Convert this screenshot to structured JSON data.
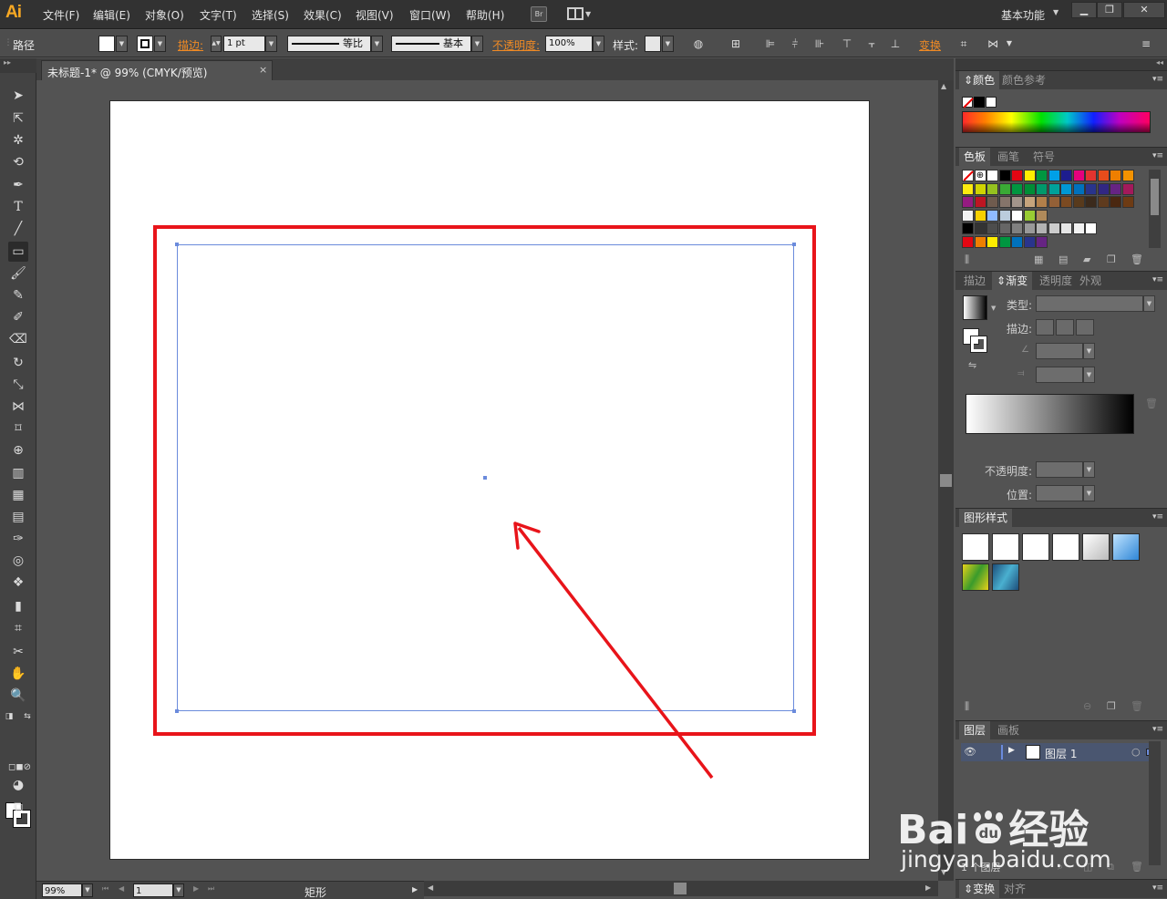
{
  "app": {
    "logo": "Ai",
    "menu": [
      "文件(F)",
      "编辑(E)",
      "对象(O)",
      "文字(T)",
      "选择(S)",
      "效果(C)",
      "视图(V)",
      "窗口(W)",
      "帮助(H)"
    ],
    "bridge_label": "Br",
    "workspace": "基本功能"
  },
  "control_bar": {
    "selection_label": "路径",
    "stroke_label": "描边:",
    "stroke_weight": "1 pt",
    "profile_label": "等比",
    "brush_label": "基本",
    "opacity_label": "不透明度:",
    "opacity_value": "100%",
    "style_label": "样式:",
    "transform_label": "变换"
  },
  "document": {
    "tab_title": "未标题-1* @ 99% (CMYK/预览)",
    "close_symbol": "×"
  },
  "status_bar": {
    "zoom": "99%",
    "page": "1",
    "tool_name": "矩形"
  },
  "panels": {
    "color": {
      "tabs": [
        "颜色",
        "颜色参考"
      ]
    },
    "swatches": {
      "tabs": [
        "色板",
        "画笔",
        "符号"
      ]
    },
    "gradient": {
      "tabs": [
        "描边",
        "渐变",
        "透明度",
        "外观"
      ],
      "type_label": "类型:",
      "stroke_label": "描边:",
      "opacity_label": "不透明度:",
      "position_label": "位置:"
    },
    "graphic_styles": {
      "tabs": [
        "图形样式"
      ]
    },
    "layers": {
      "tabs": [
        "图层",
        "画板"
      ],
      "layer_name": "图层 1",
      "count_label": "1 个图层"
    },
    "bottom": {
      "tabs": [
        "变换",
        "对齐"
      ]
    }
  },
  "watermark": {
    "brand": "Bai",
    "brand_suffix": "du",
    "product": "经验",
    "url": "jingyan.baidu.com"
  },
  "colors": {
    "annotation_red": "#e8141a",
    "selection_blue": "#6b8bdc",
    "logo_orange": "#f7a823"
  }
}
